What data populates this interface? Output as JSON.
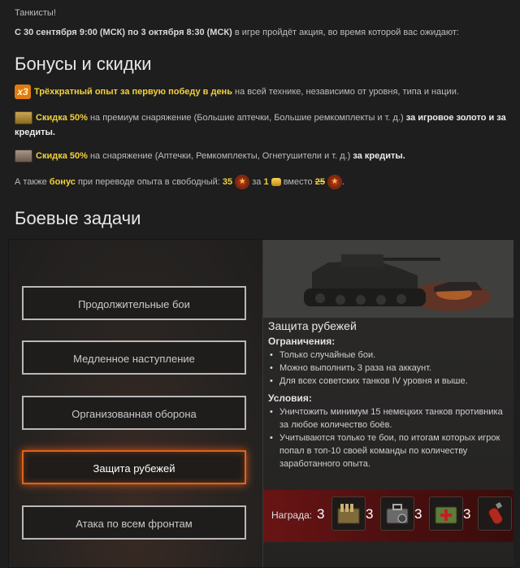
{
  "intro": {
    "greeting": "Танкисты!",
    "dates_bold": "С 30 сентября 9:00 (МСК) по 3 октября 8:30 (МСК)",
    "dates_rest": " в игре пройдёт акция, во время которой вас ожидают:"
  },
  "bonuses": {
    "heading": "Бонусы и скидки",
    "item1": {
      "icon": "x3",
      "highlight": "Трёхкратный опыт за первую победу в день",
      "rest": " на всей технике, независимо от уровня, типа и нации."
    },
    "item2": {
      "highlight": "Скидка 50%",
      "middle": " на премиум снаряжение (Большие аптечки, Большие ремкомплекты и т. д.) ",
      "tail": "за игровое золото и за кредиты."
    },
    "item3": {
      "highlight": "Скидка 50%",
      "middle": " на снаряжение (Аптечки, Ремкомплекты, Огнетушители и т. д.) ",
      "tail": "за кредиты."
    },
    "item4": {
      "pre": "А также ",
      "bonus": "бонус",
      "mid": " при переводе опыта в свободный: ",
      "num1": "35",
      "for": " за ",
      "num2": "1",
      "instead": " вместо ",
      "num3": "25",
      "end": "."
    }
  },
  "tasks": {
    "heading": "Боевые задачи",
    "buttons": [
      "Продолжительные бои",
      "Медленное наступление",
      "Организованная оборона",
      "Защита рубежей",
      "Атака по всем фронтам"
    ],
    "active_index": 3,
    "detail": {
      "title": "Защита рубежей",
      "restrictions_title": "Ограничения:",
      "restrictions": [
        "Только случайные бои.",
        "Можно выполнить 3 раза на аккаунт.",
        "Для всех советских танков IV уровня и выше."
      ],
      "conditions_title": "Условия:",
      "conditions": [
        "Уничтожить минимум 15 немецких танков противника за любое количество боёв.",
        "Учитываются только те бои, по итогам которых игрок попал в топ-10 своей команды по количеству заработанного опыта."
      ]
    },
    "reward": {
      "label": "Награда:",
      "items": [
        {
          "count": "3",
          "icon": "ammo-crate-icon"
        },
        {
          "count": "3",
          "icon": "repair-kit-icon"
        },
        {
          "count": "3",
          "icon": "first-aid-kit-icon"
        },
        {
          "count": "3",
          "icon": "fire-extinguisher-icon"
        }
      ]
    }
  },
  "colors": {
    "accent_orange": "#e0621c",
    "highlight_yellow": "#f2d13a"
  }
}
